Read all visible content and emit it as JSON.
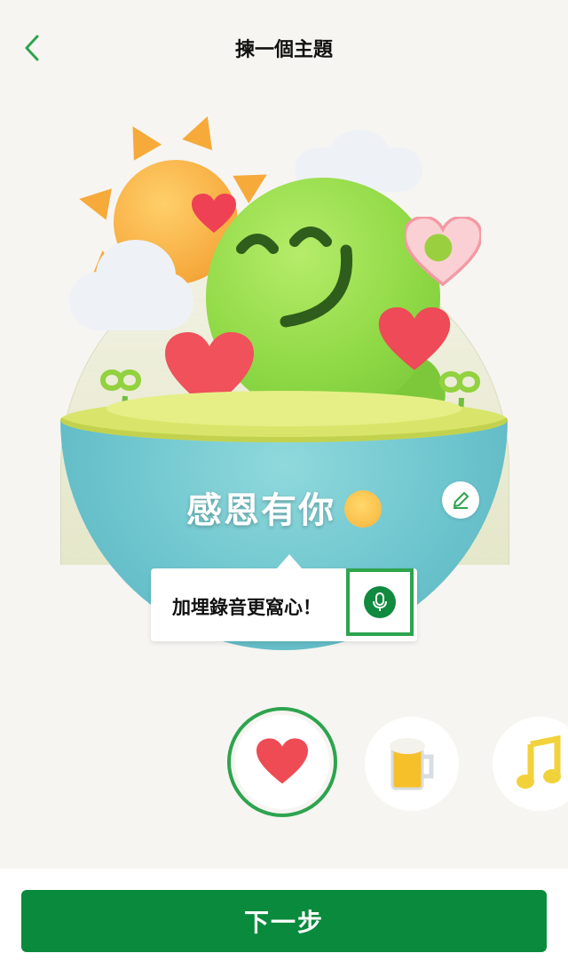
{
  "header": {
    "title": "揀一個主題",
    "back_icon": "chevron-left-icon"
  },
  "card": {
    "message": "感恩有你",
    "message_emoji": "smiling-face-with-hearts-emoji",
    "edit_icon": "pencil-icon"
  },
  "tooltip": {
    "text": "加埋錄音更窩心！",
    "mic_icon": "microphone-icon"
  },
  "themes": [
    {
      "name": "heart",
      "icon": "heart-icon",
      "selected": true
    },
    {
      "name": "beer",
      "icon": "beer-mug-icon",
      "selected": false
    },
    {
      "name": "music",
      "icon": "music-note-icon",
      "selected": false
    }
  ],
  "footer": {
    "next_label": "下一步"
  },
  "colors": {
    "accent": "#0a8a3c",
    "selection": "#2da44e",
    "background": "#f6f5f1"
  }
}
